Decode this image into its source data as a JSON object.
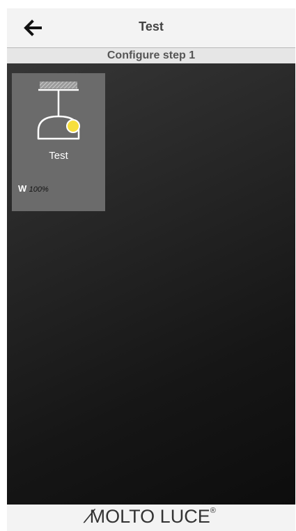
{
  "header": {
    "back_icon": "arrow-left-icon",
    "title": "Test"
  },
  "subheader": {
    "text": "Configure step 1"
  },
  "tiles": [
    {
      "icon": "pendant-lamp-icon",
      "indicator_color": "#f7df3c",
      "name": "Test",
      "channel": "W",
      "value": "100%"
    }
  ],
  "footer": {
    "brand_slash": "/",
    "brand_rest": "MOLTO LUCE",
    "brand_mark": "®"
  }
}
